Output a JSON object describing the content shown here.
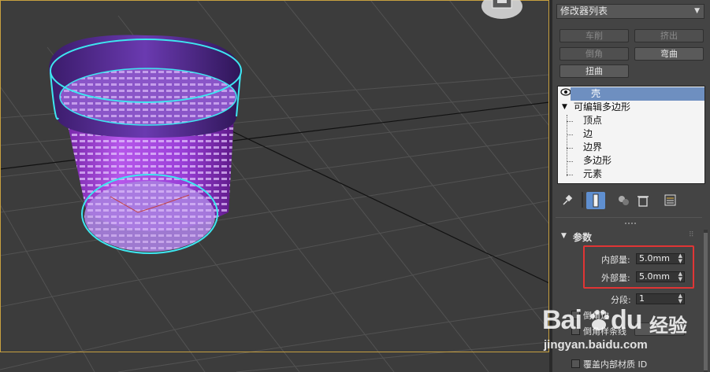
{
  "modifier_list": {
    "label": "修改器列表"
  },
  "modifier_buttons": [
    {
      "label": "车削",
      "enabled": false
    },
    {
      "label": "挤出",
      "enabled": false
    },
    {
      "label": "倒角",
      "enabled": false
    },
    {
      "label": "弯曲",
      "enabled": true
    },
    {
      "label": "扭曲",
      "enabled": true
    }
  ],
  "stack": {
    "top": "壳",
    "base": "可编辑多边形",
    "subobjects": [
      "顶点",
      "边",
      "边界",
      "多边形",
      "元素"
    ]
  },
  "rollout": {
    "title": "参数",
    "inner_label": "内部量:",
    "inner_value": "5.0mm",
    "outer_label": "外部量:",
    "outer_value": "5.0mm",
    "segments_label": "分段:",
    "segments_value": "1",
    "check1_label": "倒角边",
    "check2_label": "倒角样条线",
    "override_label": "覆盖内部材质 ID"
  },
  "watermark": {
    "brand_a": "Bai",
    "brand_b": "du",
    "brand_cn": "经验",
    "url": "jingyan.baidu.com"
  },
  "colors": {
    "highlight": "#e03535",
    "selection": "#6e8fc0",
    "object": "#9a3fd8",
    "outline": "#3ee6f0"
  }
}
